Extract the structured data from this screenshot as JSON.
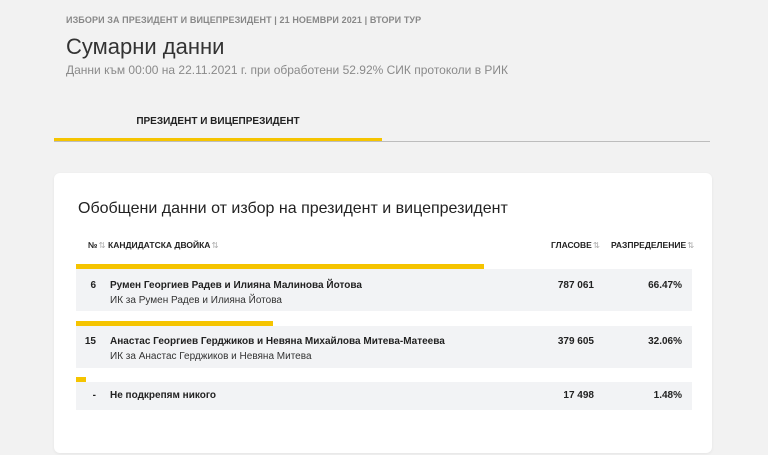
{
  "header": {
    "breadcrumb": "ИЗБОРИ ЗА ПРЕЗИДЕНТ И ВИЦЕПРЕЗИДЕНТ | 21 НОЕМВРИ 2021 | ВТОРИ ТУР",
    "title": "Сумарни данни",
    "subtitle": "Данни към 00:00 на 22.11.2021 г. при обработени 52.92% СИК протоколи в РИК"
  },
  "tabs": [
    {
      "label": "ПРЕЗИДЕНТ И ВИЦЕПРЕЗИДЕНТ",
      "active": true
    }
  ],
  "card": {
    "title": "Обобщени данни от избор на президент и вицепрезидент",
    "columns": {
      "number": "№",
      "candidates": "КАНДИДАТСКА ДВОЙКА",
      "votes": "ГЛАСОВЕ",
      "share": "РАЗПРЕДЕЛЕНИЕ",
      "sort_icon": "⇅"
    },
    "rows": [
      {
        "number": "6",
        "name": "Румен Георгиев Радев и Илияна Малинова Йотова",
        "committee": "ИК за Румен Радев и Илияна Йотова",
        "votes": "787 061",
        "share": "66.47%",
        "share_value": 66.47
      },
      {
        "number": "15",
        "name": "Анастас Георгиев Герджиков и Невяна Михайлова Митева-Матеева",
        "committee": "ИК за Анастас Герджиков и Невяна Митева",
        "votes": "379 605",
        "share": "32.06%",
        "share_value": 32.06
      },
      {
        "number": "-",
        "name": "Не подкрепям никого",
        "committee": "",
        "votes": "17 498",
        "share": "1.48%",
        "share_value": 1.48
      }
    ]
  },
  "colors": {
    "accent": "#f5c400",
    "row_background": "#f2f3f5",
    "page_background": "#f2f2f2"
  }
}
